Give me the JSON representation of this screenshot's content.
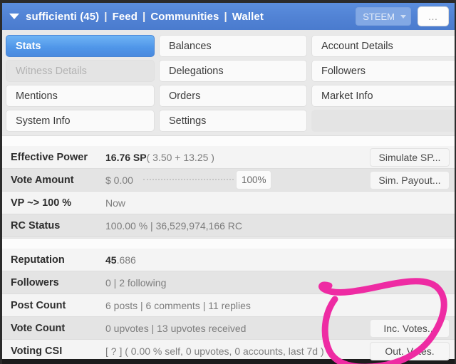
{
  "header": {
    "account_label": "sufficienti (45)",
    "nav_items": [
      "Feed",
      "Communities",
      "Wallet"
    ],
    "separator": "|",
    "chain_select": "STEEM",
    "more_button": "…",
    "caret_icon": "caret-down-icon",
    "bg_color": "#5182d4"
  },
  "tabs": {
    "rows": [
      [
        {
          "label": "Stats",
          "state": "active"
        },
        {
          "label": "Balances",
          "state": "normal"
        },
        {
          "label": "Account Details",
          "state": "normal"
        }
      ],
      [
        {
          "label": "Witness Details",
          "state": "disabled"
        },
        {
          "label": "Delegations",
          "state": "normal"
        },
        {
          "label": "Followers",
          "state": "normal"
        }
      ],
      [
        {
          "label": "Mentions",
          "state": "normal"
        },
        {
          "label": "Orders",
          "state": "normal"
        },
        {
          "label": "Market Info",
          "state": "normal"
        }
      ],
      [
        {
          "label": "System Info",
          "state": "normal"
        },
        {
          "label": "Settings",
          "state": "normal"
        },
        {
          "label": "",
          "state": "empty"
        }
      ]
    ],
    "active_color": "#4f95e8"
  },
  "stats_top": [
    {
      "label": "Effective Power",
      "value_strong": "16.76 SP",
      "value_rest": " ( 3.50 + 13.25 )",
      "button": "Simulate SP..."
    },
    {
      "label": "Vote Amount",
      "value_strong": "",
      "value_rest": "$ 0.00",
      "slider_value": "100%",
      "button": "Sim. Payout..."
    },
    {
      "label": "VP ~> 100 %",
      "value_strong": "",
      "value_rest": "Now",
      "button": ""
    },
    {
      "label": "RC Status",
      "value_strong": "",
      "value_rest": "100.00 %  |  36,529,974,166 RC",
      "button": ""
    }
  ],
  "stats_bottom": [
    {
      "label": "Reputation",
      "value_strong": "45",
      "value_rest": ".686",
      "button": ""
    },
    {
      "label": "Followers",
      "value_strong": "",
      "value_rest": "0  |  2 following",
      "button": ""
    },
    {
      "label": "Post Count",
      "value_strong": "",
      "value_rest": "6 posts  |  6 comments  |  11 replies",
      "button": ""
    },
    {
      "label": "Vote Count",
      "value_strong": "",
      "value_rest": "0 upvotes  |  13 upvotes received",
      "button": "Inc. Votes..."
    },
    {
      "label": "Voting CSI",
      "value_strong": "",
      "value_rest": "[ ? ] ( 0.00 % self, 0 upvotes, 0 accounts, last 7d )",
      "button": "Out. Votes."
    }
  ],
  "annotation": {
    "shape": "hand-drawn-circle",
    "color": "#ee2ba3",
    "target": "votes-buttons"
  }
}
